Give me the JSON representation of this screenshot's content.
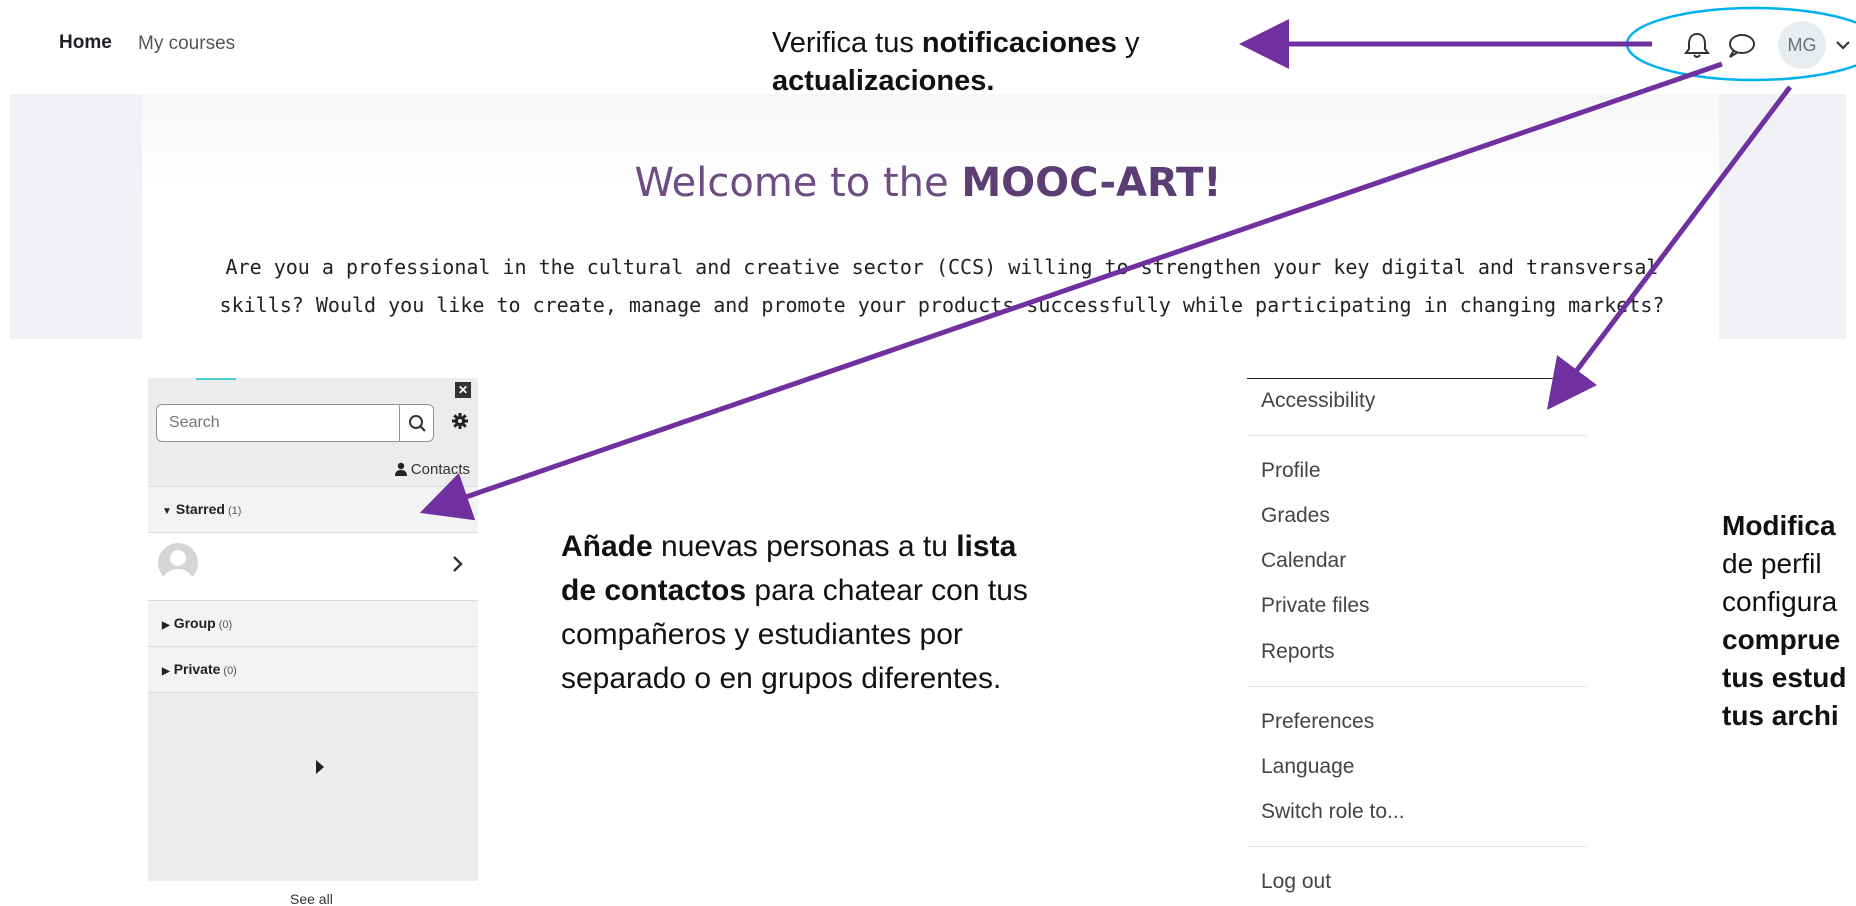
{
  "navbar": {
    "home": "Home",
    "my_courses": "My courses",
    "avatar_initials": "MG",
    "icons": [
      "bell-icon",
      "chat-icon",
      "chevron-down-icon"
    ]
  },
  "hero": {
    "title_prefix": "Welcome to the ",
    "title_bold": "MOOC-ART!",
    "text": "Are you a professional in the cultural and creative sector (CCS) willing to strengthen your key digital and transversal skills? Would you like to create, manage and promote your products successfully while participating in changing markets?"
  },
  "annotations": {
    "top": {
      "p1": "Verifica tus ",
      "b1": "notificaciones",
      "p2": " y ",
      "b2": "actualizaciones."
    },
    "contacts": {
      "b1": "Añade",
      "p1": " nuevas personas a tu ",
      "b2": "lista de contactos",
      "p2": " para chatear con tus compañeros y estudiantes por separado o en grupos diferentes."
    },
    "right": {
      "b1": "Modifica",
      "l2": "de perfil",
      "l3": "configura",
      "b4": "comprue",
      "b5": "tus estud",
      "b6": "tus archi"
    }
  },
  "messaging": {
    "search_placeholder": "Search",
    "contacts_label": "Contacts",
    "starred_label": "Starred",
    "starred_count": "(1)",
    "group_label": "Group",
    "group_count": "(0)",
    "private_label": "Private",
    "private_count": "(0)",
    "see_all": "See all"
  },
  "user_menu": {
    "items": [
      "Accessibility",
      "Profile",
      "Grades",
      "Calendar",
      "Private files",
      "Reports",
      "Preferences",
      "Language",
      "Switch role to...",
      "Log out"
    ]
  },
  "colors": {
    "arrow": "#7030a0",
    "highlight_ellipse": "#00b0f0",
    "title": "#6d4d83"
  }
}
